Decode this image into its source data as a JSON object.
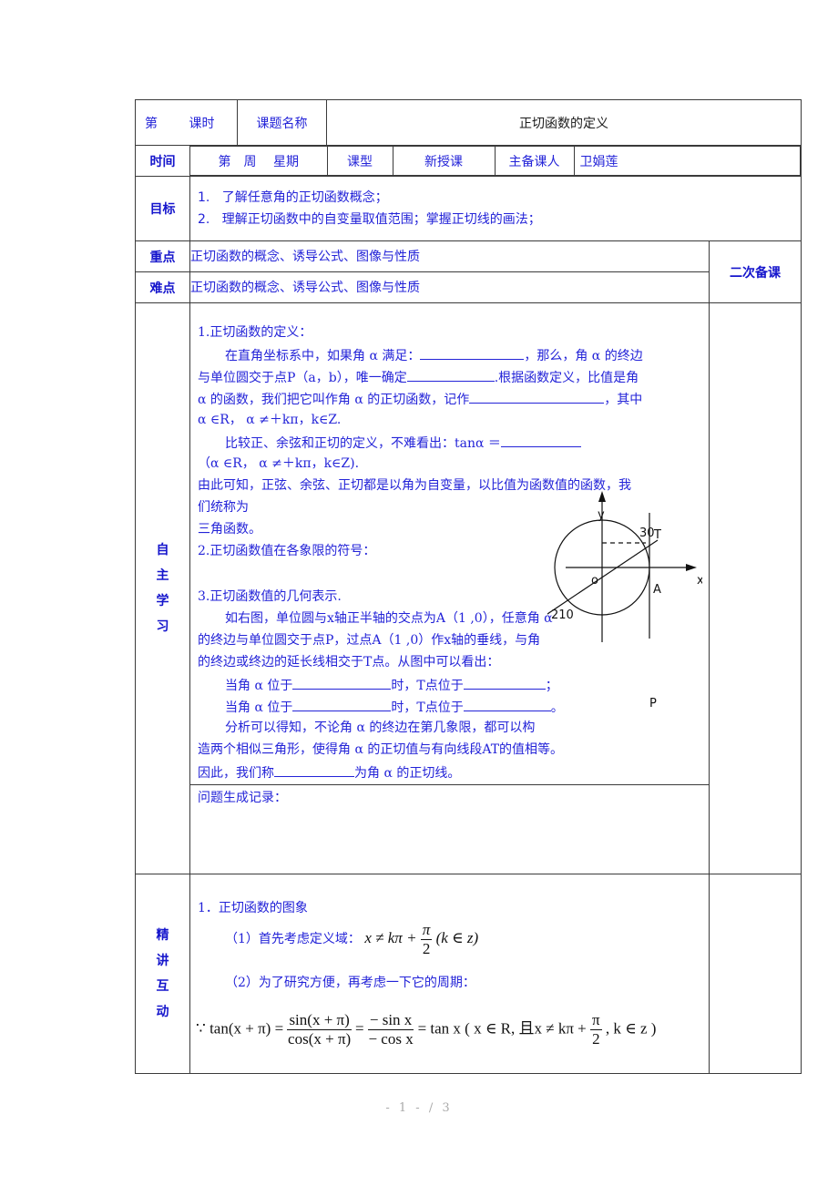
{
  "header": {
    "lesson_label_a": "第",
    "lesson_label_b": "课时",
    "topic_label": "课题名称",
    "topic_title": "正切函数的定义",
    "time_label": "时间",
    "week_label": "第　周　 星期",
    "type_label": "课型",
    "type_value": "新授课",
    "preparer_label": "主备课人",
    "preparer_value": "卫娟莲"
  },
  "goals": {
    "label": "目标",
    "items": [
      {
        "num": "1.",
        "text": "了解任意角的正切函数概念；"
      },
      {
        "num": "2.",
        "text": "理解正切函数中的自变量取值范围；掌握正切线的画法；"
      }
    ]
  },
  "key_point": {
    "label": "重点",
    "text": "正切函数的概念、诱导公式、图像与性质"
  },
  "difficulty": {
    "label": "难点",
    "text": "正切函数的概念、诱导公式、图像与性质"
  },
  "second_prep_label": "二次备课",
  "self_study": {
    "label_chars": [
      "自",
      "主",
      "学",
      "习"
    ],
    "lines": [
      "1.正切函数的定义：",
      "在直角坐标系中，如果角 α 满足：",
      "，那么，角 α 的终边",
      "与单位圆交于点P（a，b），唯一确定",
      ".根据函数定义，比值是角",
      "α 的函数，我们把它叫作角 α 的正切函数，记作",
      "，其中",
      "α ∈R， α ≠＋kπ，k∈Z.",
      "比较正、余弦和正切的定义，不难看出：tanα ＝",
      "（α ∈R， α ≠＋kπ，k∈Z).",
      "由此可知，正弦、余弦、正切都是以角为自变量，以比值为函数值的函数，我",
      "们统称为",
      "三角函数。",
      "2.正切函数值在各象限的符号：",
      "3.正切函数值的几何表示.",
      "如右图，单位圆与x轴正半轴的交点为A（1 ,0），任意角 α",
      "的终边与单位圆交于点P，过点A（1 ,0）作x轴的垂线，与角",
      "的终边或终边的延长线相交于T点。从图中可以看出：",
      "当角 α 位于",
      "时，T点位于",
      "；",
      "。",
      "分析可以得知，不论角 α 的终边在第几象限，都可以构",
      "造两个相似三角形，使得角 α 的正切值与有向线段AT的值相等。",
      "因此，我们称",
      "为角 α 的正切线。"
    ],
    "diagram": {
      "y_label": "y",
      "x_label": "x",
      "origin_label": "o",
      "a_label": "A",
      "t_label": "T",
      "angle_30": "30",
      "angle_210": "210",
      "p_label": "P"
    },
    "record_label": "问题生成记录："
  },
  "lecture": {
    "label_chars": [
      "精",
      "讲",
      "互",
      "动"
    ],
    "item1": "1．正切函数的图象",
    "item1_1": "（1）首先考虑定义域：",
    "item1_2": "（2）为了研究方便，再考虑一下它的周期：",
    "domain_formula": {
      "lhs": "x ≠ kπ +",
      "num": "π",
      "den": "2",
      "rhs": "(k ∈ z)"
    },
    "period_formula": {
      "because": "∵",
      "lhs": "tan(x + π) =",
      "f1_num": "sin(x + π)",
      "f1_den": "cos(x + π)",
      "eq1": "=",
      "f2_num": "− sin x",
      "f2_den": "− cos x",
      "eq2": "= tan x",
      "cond_a": "( x ∈ R, 且x ≠ kπ +",
      "cond_num": "π",
      "cond_den": "2",
      "cond_b": ", k ∈ z )"
    }
  },
  "footer": {
    "page": "- 1 - / 3"
  }
}
